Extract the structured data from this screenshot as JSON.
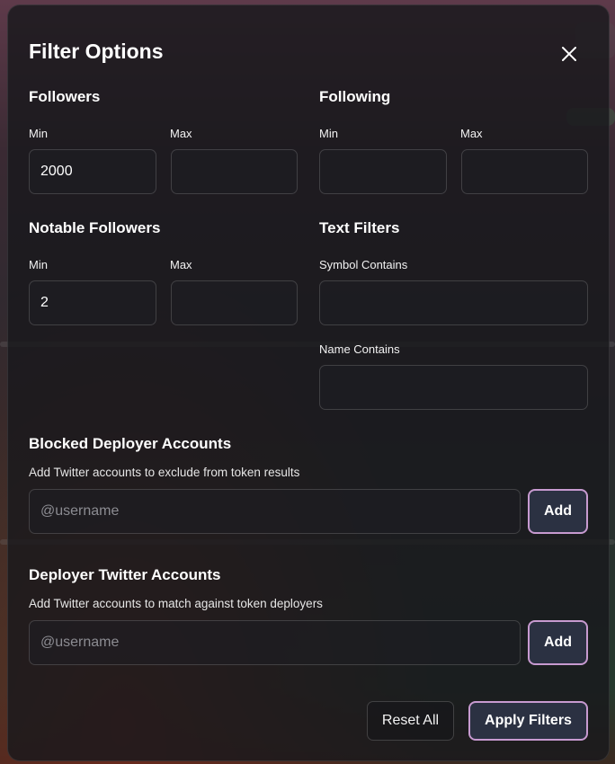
{
  "modal": {
    "title": "Filter Options",
    "close_icon": "close-icon"
  },
  "followers": {
    "title": "Followers",
    "min_label": "Min",
    "max_label": "Max",
    "min_value": "2000",
    "max_value": ""
  },
  "following": {
    "title": "Following",
    "min_label": "Min",
    "max_label": "Max",
    "min_value": "",
    "max_value": ""
  },
  "notable_followers": {
    "title": "Notable Followers",
    "min_label": "Min",
    "max_label": "Max",
    "min_value": "2",
    "max_value": ""
  },
  "text_filters": {
    "title": "Text Filters",
    "symbol_label": "Symbol Contains",
    "symbol_value": "",
    "name_label": "Name Contains",
    "name_value": ""
  },
  "blocked_deployers": {
    "title": "Blocked Deployer Accounts",
    "description": "Add Twitter accounts to exclude from token results",
    "placeholder": "@username",
    "add_label": "Add"
  },
  "deployer_twitter": {
    "title": "Deployer Twitter Accounts",
    "description": "Add Twitter accounts to match against token deployers",
    "placeholder": "@username",
    "add_label": "Add"
  },
  "footer": {
    "reset_label": "Reset All",
    "apply_label": "Apply Filters"
  },
  "colors": {
    "accent_border": "#c79ad0",
    "button_bg": "#2b3142",
    "modal_bg": "#18181c"
  }
}
